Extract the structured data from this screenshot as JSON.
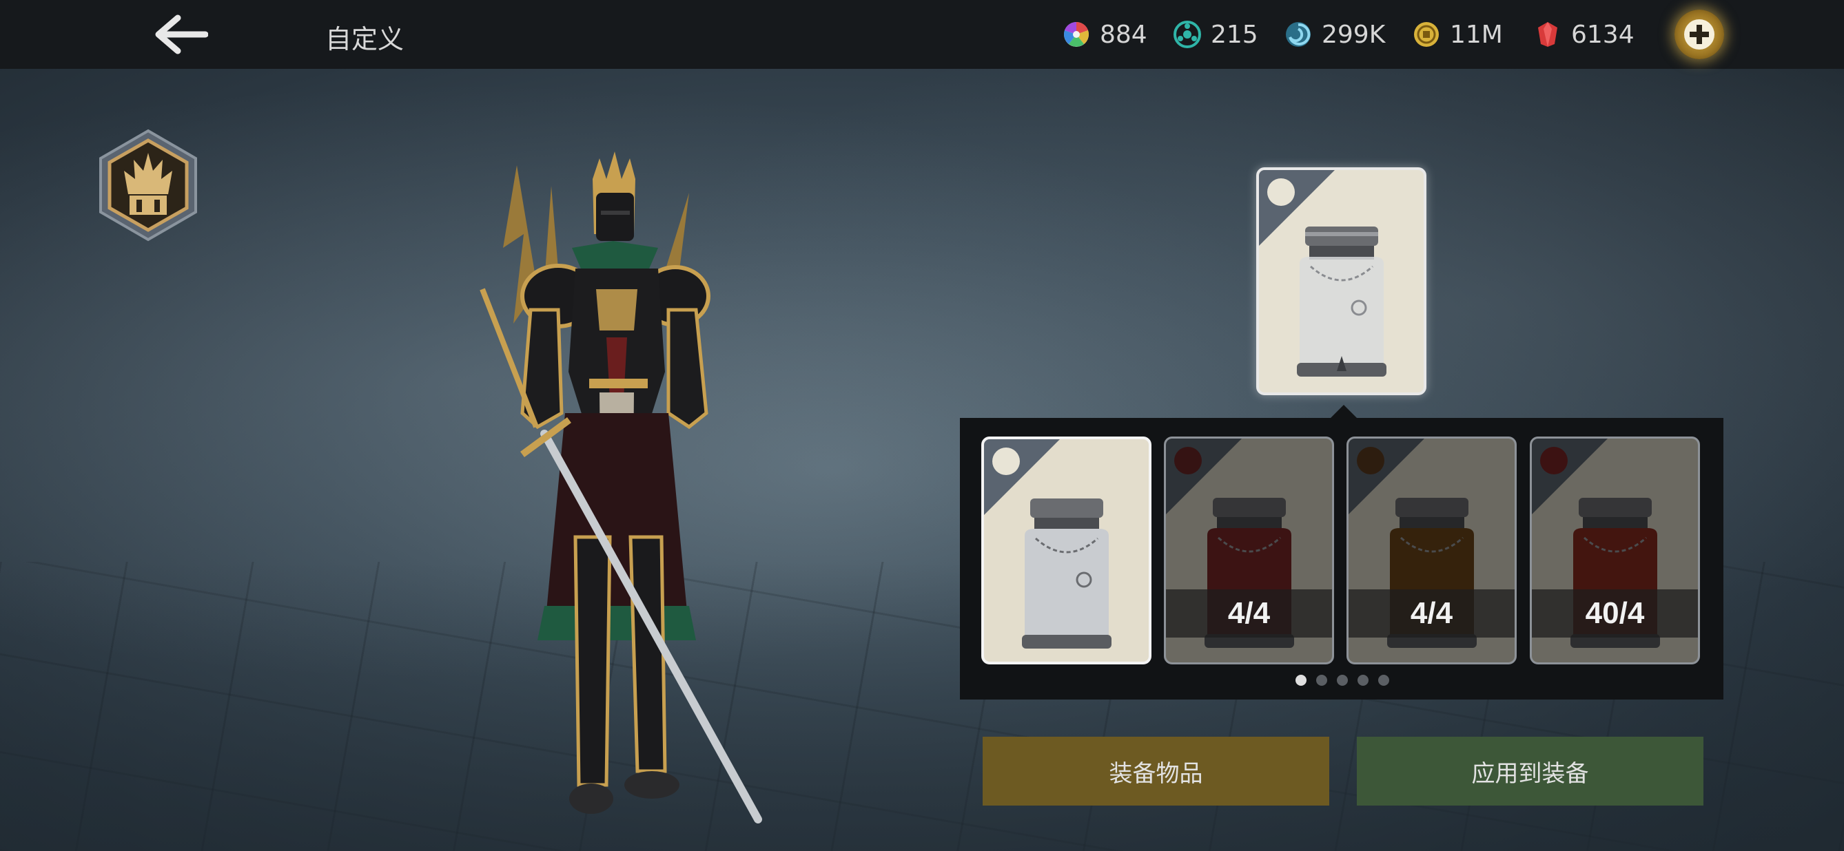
{
  "header": {
    "title": "自定义",
    "back_icon": "back-arrow-icon"
  },
  "currencies": [
    {
      "icon": "color-wheel-icon",
      "value": "884",
      "color": "#c85a8a"
    },
    {
      "icon": "teal-emblem-icon",
      "value": "215",
      "color": "#2fb5a8"
    },
    {
      "icon": "swirl-icon",
      "value": "299K",
      "color": "#3fa6c8"
    },
    {
      "icon": "gold-coin-icon",
      "value": "11M",
      "color": "#d8b23a"
    },
    {
      "icon": "red-gem-icon",
      "value": "6134",
      "color": "#d83a3a"
    }
  ],
  "emblem_icon": "demon-crown-emblem-icon",
  "preview": {
    "item": "silver-jar",
    "dot_color": "#e8e4d6"
  },
  "items": [
    {
      "name": "silver-jar",
      "dot_color": "#e8e4d6",
      "tint": "#c9ccd0",
      "count": "",
      "selected": true
    },
    {
      "name": "red-jar",
      "dot_color": "#6a1f1f",
      "tint": "#7a2020",
      "count": "4/4",
      "selected": false
    },
    {
      "name": "brown-jar",
      "dot_color": "#5a3518",
      "tint": "#6a4010",
      "count": "4/4",
      "selected": false
    },
    {
      "name": "crimson-jar",
      "dot_color": "#7a1e1e",
      "tint": "#8a2418",
      "count": "40/4",
      "selected": false
    }
  ],
  "pager": {
    "total": 5,
    "active": 0
  },
  "buttons": {
    "equip": "装备物品",
    "apply": "应用到装备"
  }
}
